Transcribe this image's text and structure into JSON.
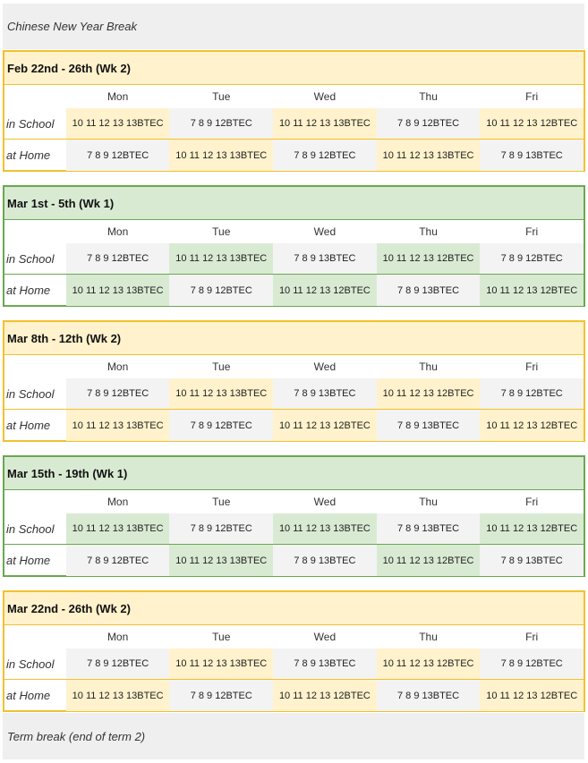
{
  "notes": {
    "top": "Chinese New Year Break",
    "bottom": "Term break (end of term 2)"
  },
  "days": [
    "Mon",
    "Tue",
    "Wed",
    "Thu",
    "Fri"
  ],
  "row_labels": [
    "in School",
    "at Home"
  ],
  "colors": {
    "yellow": "#f2c12e",
    "yellow_fill": "#fff2cc",
    "green": "#6aa84f",
    "green_fill": "#d9ead3",
    "grey": "#f3f3f3"
  },
  "weeks": [
    {
      "title": "Feb 22nd - 26th (Wk 2)",
      "theme": "yellow",
      "rows": [
        [
          "10 11 12 13 13BTEC",
          "7 8 9 12BTEC",
          "10 11 12 13 13BTEC",
          "7 8 9 12BTEC",
          "10 11 12 13 12BTEC"
        ],
        [
          "7 8 9 12BTEC",
          "10 11 12 13 13BTEC",
          "7 8 9 12BTEC",
          "10 11 12 13 13BTEC",
          "7 8 9 13BTEC"
        ]
      ]
    },
    {
      "title": "Mar 1st - 5th (Wk 1)",
      "theme": "green",
      "rows": [
        [
          "7 8 9 12BTEC",
          "10 11 12 13 13BTEC",
          "7 8 9 13BTEC",
          "10 11 12 13 12BTEC",
          "7 8 9 12BTEC"
        ],
        [
          "10 11 12 13 13BTEC",
          "7 8 9 12BTEC",
          "10 11 12 13 12BTEC",
          "7 8 9 13BTEC",
          "10 11 12 13 12BTEC"
        ]
      ]
    },
    {
      "title": "Mar 8th - 12th (Wk 2)",
      "theme": "yellow",
      "rows": [
        [
          "7 8 9 12BTEC",
          "10 11 12 13 13BTEC",
          "7 8 9 13BTEC",
          "10 11 12 13 12BTEC",
          "7 8 9 12BTEC"
        ],
        [
          "10 11 12 13 13BTEC",
          "7 8 9 12BTEC",
          "10 11 12 13 12BTEC",
          "7 8 9 13BTEC",
          "10 11 12 13 12BTEC"
        ]
      ]
    },
    {
      "title": "Mar 15th - 19th (Wk 1)",
      "theme": "green",
      "rows": [
        [
          "10 11 12 13 13BTEC",
          "7 8 9 12BTEC",
          "10 11 12 13 13BTEC",
          "7 8 9 13BTEC",
          "10 11 12 13 12BTEC"
        ],
        [
          "7 8 9 12BTEC",
          "10 11 12 13 13BTEC",
          "7 8 9 13BTEC",
          "10 11 12 13 12BTEC",
          "7 8 9 13BTEC"
        ]
      ]
    },
    {
      "title": "Mar 22nd - 26th (Wk 2)",
      "theme": "yellow",
      "rows": [
        [
          "7 8 9 12BTEC",
          "10 11 12 13 13BTEC",
          "7 8 9 13BTEC",
          "10 11 12 13 12BTEC",
          "7 8 9 12BTEC"
        ],
        [
          "10 11 12 13 13BTEC",
          "7 8 9 12BTEC",
          "10 11 12 13 12BTEC",
          "7 8 9 13BTEC",
          "10 11 12 13 12BTEC"
        ]
      ]
    }
  ]
}
